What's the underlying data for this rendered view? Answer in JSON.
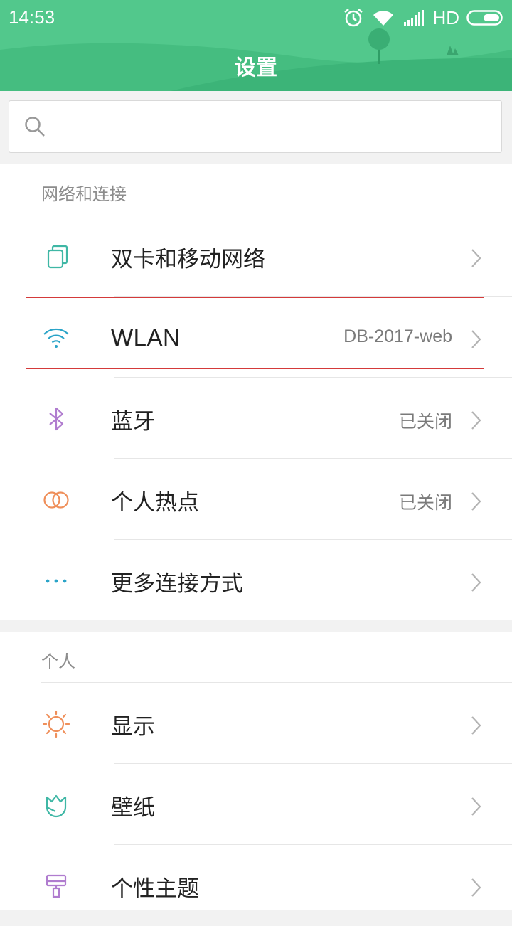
{
  "status_bar": {
    "time": "14:53",
    "network_type": "HD",
    "icons": [
      "alarm-icon",
      "wifi-icon",
      "signal-icon",
      "battery-icon"
    ]
  },
  "header": {
    "title": "设置"
  },
  "search": {
    "placeholder": "",
    "icon": "search-icon"
  },
  "sections": {
    "network": {
      "title": "网络和连接",
      "items": [
        {
          "label": "双卡和移动网络",
          "value": "",
          "icon": "sim-cards-icon",
          "icon_color": "#3fb7a5"
        },
        {
          "label": "WLAN",
          "value": "DB-2017-web",
          "icon": "wifi-icon",
          "icon_color": "#2aa4c8"
        },
        {
          "label": "蓝牙",
          "value": "已关闭",
          "icon": "bluetooth-icon",
          "icon_color": "#b07ccf"
        },
        {
          "label": "个人热点",
          "value": "已关闭",
          "icon": "hotspot-icon",
          "icon_color": "#ef8f5a"
        },
        {
          "label": "更多连接方式",
          "value": "",
          "icon": "more-dots-icon",
          "icon_color": "#2aa4c8"
        }
      ]
    },
    "personal": {
      "title": "个人",
      "items": [
        {
          "label": "显示",
          "value": "",
          "icon": "brightness-icon",
          "icon_color": "#ef8f5a"
        },
        {
          "label": "壁纸",
          "value": "",
          "icon": "wallpaper-icon",
          "icon_color": "#3fb7a5"
        },
        {
          "label": "个性主题",
          "value": "",
          "icon": "theme-brush-icon",
          "icon_color": "#b07ccf"
        }
      ]
    }
  },
  "colors": {
    "header_bg": "#52c88c",
    "highlight_border": "#d43a3a"
  }
}
